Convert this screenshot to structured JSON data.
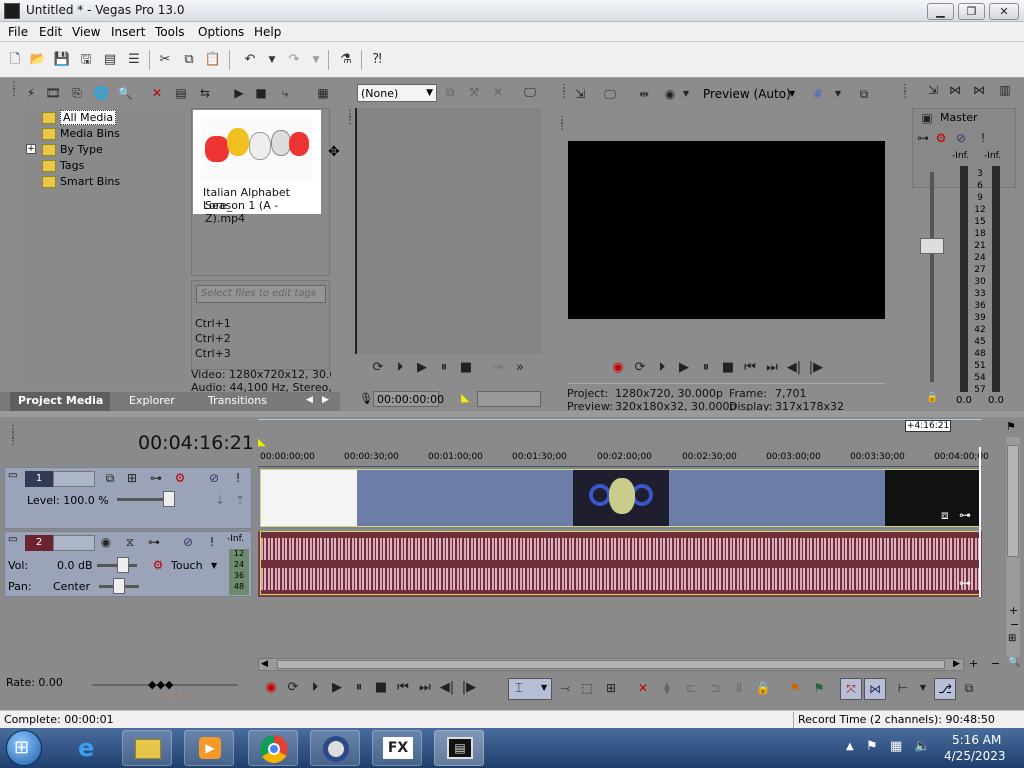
{
  "window": {
    "title": "Untitled * - Vegas Pro 13.0"
  },
  "menu": [
    "File",
    "Edit",
    "View",
    "Insert",
    "Tools",
    "Options",
    "Help"
  ],
  "project_media": {
    "tree": [
      "All Media",
      "Media Bins",
      "By Type",
      "Tags",
      "Smart Bins"
    ],
    "file_name_line1": "Italian Alphabet Lore_",
    "file_name_line2": "Season 1 (A - Z).mp4",
    "tag_placeholder": "Select files to edit tags",
    "shortcuts": [
      "Ctrl+1",
      "Ctrl+2",
      "Ctrl+3"
    ],
    "video_info": "Video: 1280x720x12, 30.000",
    "audio_info": "Audio: 44,100 Hz, Stereo, 00"
  },
  "tabs": [
    "Project Media",
    "Explorer",
    "Transitions"
  ],
  "trimmer": {
    "dropdown": "(None)",
    "timecode": "00:00:00:00"
  },
  "preview": {
    "mode": "Preview (Auto)",
    "project_label": "Project:",
    "project_value": "1280x720, 30.000p",
    "preview_label": "Preview:",
    "preview_value": "320x180x32, 30.000p",
    "frame_label": "Frame:",
    "frame_value": "7,701",
    "display_label": "Display:",
    "display_value": "317x178x32"
  },
  "master": {
    "label": "Master",
    "inf_left": "-Inf.",
    "inf_right": "-Inf.",
    "scale": [
      "3",
      "6",
      "9",
      "12",
      "15",
      "18",
      "21",
      "24",
      "27",
      "30",
      "33",
      "36",
      "39",
      "42",
      "45",
      "48",
      "51",
      "54",
      "57"
    ],
    "bottom_left": "0.0",
    "bottom_right": "0.0"
  },
  "timeline": {
    "timecode": "00:04:16:21",
    "marker": "+4:16:21",
    "ruler": [
      "00:00:00;00",
      "00:00:30;00",
      "00:01:00;00",
      "00:01:30;00",
      "00:02:00;00",
      "00:02:30;00",
      "00:03:00;00",
      "00:03:30;00",
      "00:04:00;00"
    ],
    "video_track": {
      "number": "1",
      "level": "Level: 100.0 %"
    },
    "audio_track": {
      "number": "2",
      "vol_label": "Vol:",
      "vol_value": "0.0 dB",
      "pan_label": "Pan:",
      "pan_value": "Center",
      "mode": "Touch",
      "inf": "-Inf.",
      "meter": [
        "12",
        "24",
        "36",
        "48"
      ]
    }
  },
  "transport": {
    "rate": "Rate: 0.00"
  },
  "status": {
    "left": "Complete: 00:00:01",
    "right": "Record Time (2 channels): 90:48:50"
  },
  "taskbar": {
    "time": "5:16 AM",
    "date": "4/25/2023",
    "fx_label": "FX"
  }
}
